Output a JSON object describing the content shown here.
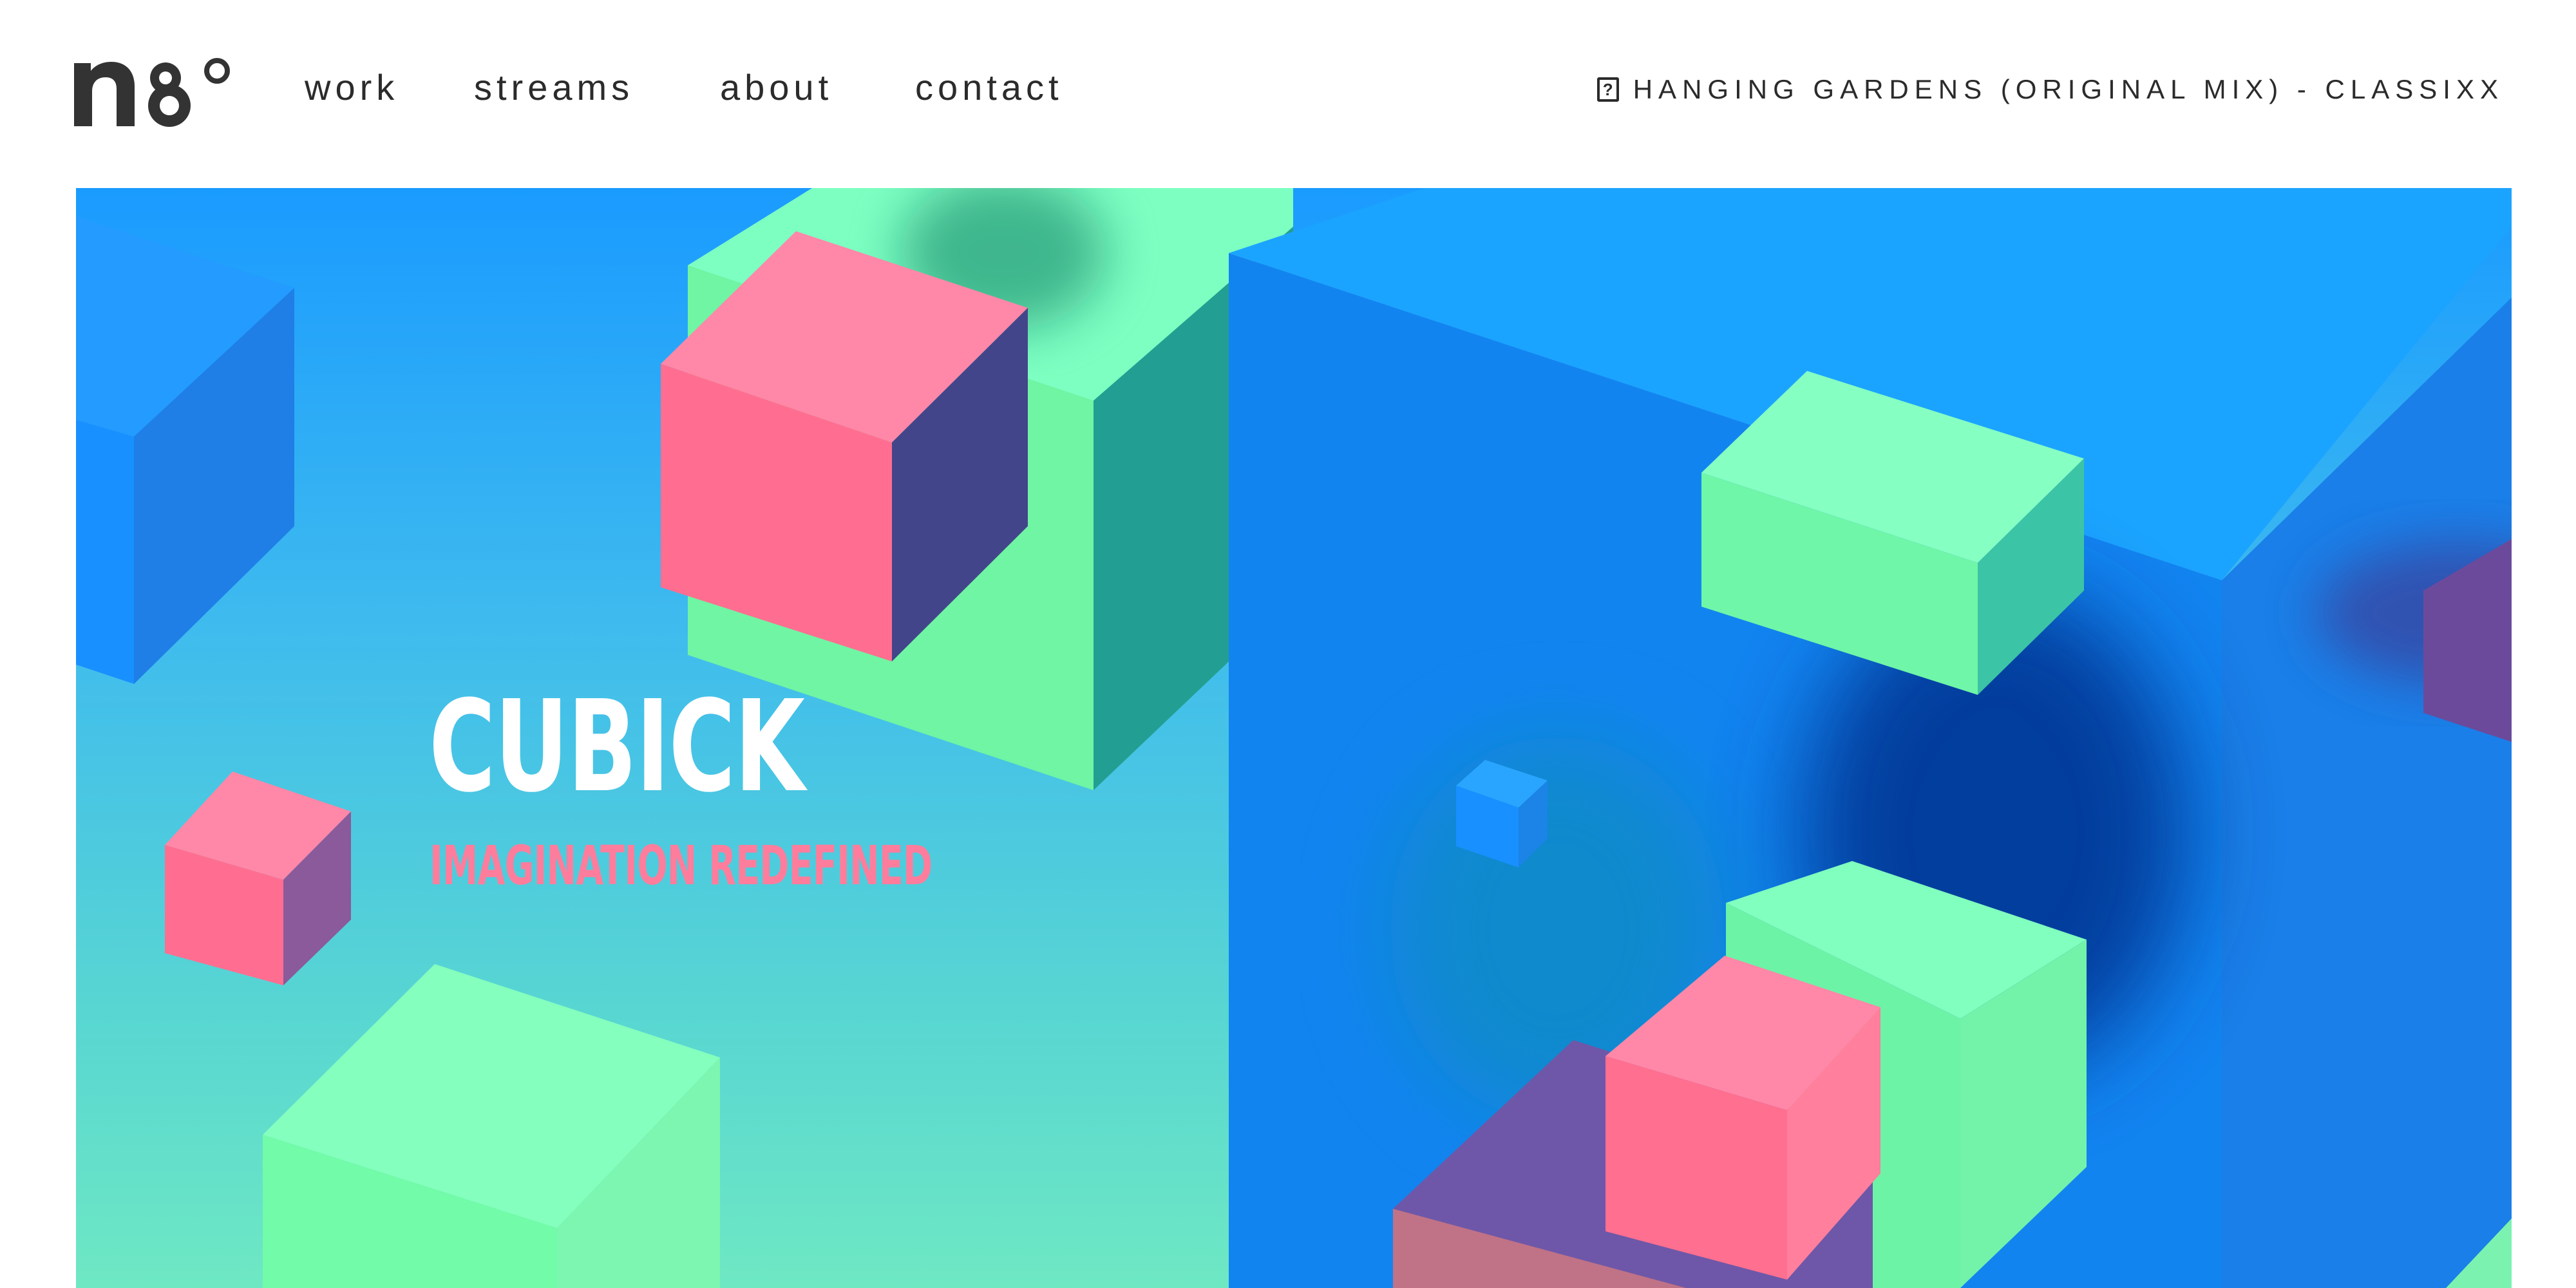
{
  "logo": {
    "icon": "ng-degree-logo",
    "alt": "ng°"
  },
  "nav": {
    "items": [
      {
        "label": "work"
      },
      {
        "label": "streams"
      },
      {
        "label": "about"
      },
      {
        "label": "contact"
      }
    ]
  },
  "now_playing": {
    "icon": "question-box-icon",
    "track": "HANGING GARDENS (ORIGINAL MIX) - CLASSIXX"
  },
  "hero": {
    "title": "CUBICK",
    "subtitle": "IMAGINATION REDEFINED",
    "colors": {
      "sky_top": "#1a9bff",
      "sky_bottom": "#6ee8c3",
      "cube_pink": "#ff6f8f",
      "cube_green": "#74f7ad",
      "cube_blue": "#1a86f0",
      "cube_purple": "#7a5aa8"
    }
  }
}
